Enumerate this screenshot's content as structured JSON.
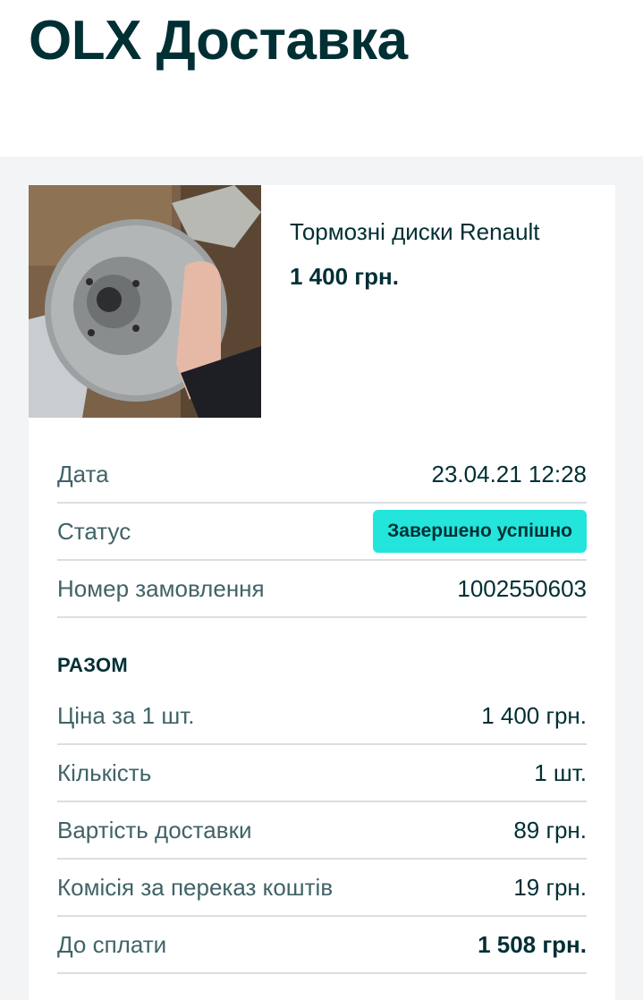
{
  "header": {
    "title": "OLX Доставка"
  },
  "product": {
    "image_alt": "brake-disc-photo",
    "title": "Тормозні диски Renault",
    "price": "1 400 грн."
  },
  "details": [
    {
      "label": "Дата",
      "value": "23.04.21 12:28"
    },
    {
      "label": "Статус",
      "value": "Завершено успішно"
    },
    {
      "label": "Номер замовлення",
      "value": "1002550603"
    }
  ],
  "summary": {
    "title": "РАЗОМ",
    "rows": [
      {
        "label": "Ціна за 1 шт.",
        "value": "1 400 грн."
      },
      {
        "label": "Кількість",
        "value": "1 шт."
      },
      {
        "label": "Вартість доставки",
        "value": "89 грн."
      },
      {
        "label": "Комісія за переказ коштів",
        "value": "19 грн."
      },
      {
        "label": "До сплати",
        "value": "1 508 грн."
      }
    ]
  },
  "colors": {
    "brand_dark": "#002f34",
    "status_accent": "#23e5db",
    "page_bg": "#f2f4f5"
  }
}
